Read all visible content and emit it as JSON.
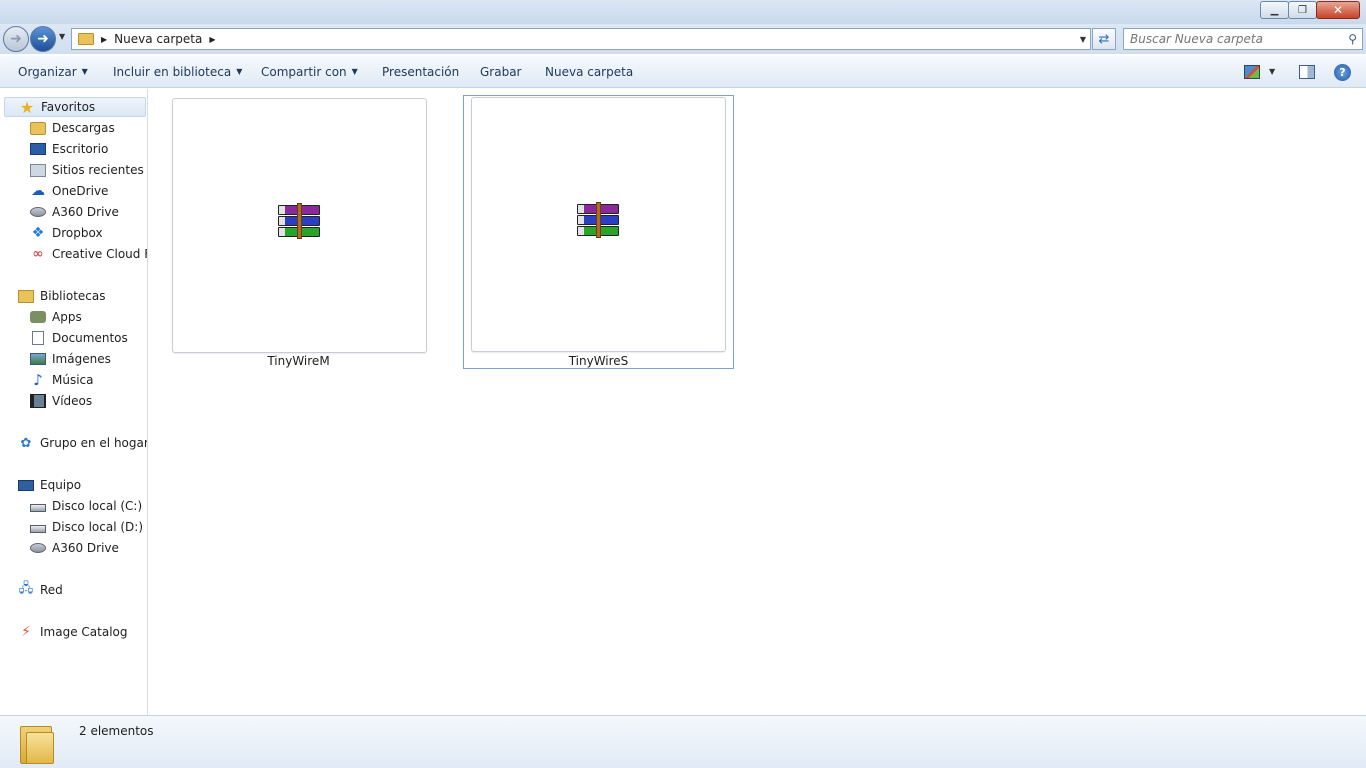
{
  "window": {
    "controls": {
      "minimize": "▁",
      "maximize": "❐",
      "close": "✕"
    }
  },
  "address": {
    "path": [
      "Nueva carpeta"
    ],
    "search_placeholder": "Buscar Nueva carpeta"
  },
  "toolbar": {
    "organize": "Organizar",
    "include_library": "Incluir en biblioteca",
    "share": "Compartir con",
    "presentation": "Presentación",
    "burn": "Grabar",
    "new_folder": "Nueva carpeta"
  },
  "navigation": {
    "favorites": {
      "label": "Favoritos",
      "items": [
        "Descargas",
        "Escritorio",
        "Sitios recientes",
        "OneDrive",
        "A360 Drive",
        "Dropbox",
        "Creative Cloud Files"
      ]
    },
    "libraries": {
      "label": "Bibliotecas",
      "items": [
        "Apps",
        "Documentos",
        "Imágenes",
        "Música",
        "Vídeos"
      ]
    },
    "homegroup": {
      "label": "Grupo en el hogar"
    },
    "computer": {
      "label": "Equipo",
      "items": [
        "Disco local (C:)",
        "Disco local (D:)",
        "A360 Drive"
      ]
    },
    "network": {
      "label": "Red"
    },
    "catalog": {
      "label": "Image Catalog"
    }
  },
  "files": [
    {
      "name": "TinyWireM",
      "icon": "winrar-archive-icon",
      "selected": false
    },
    {
      "name": "TinyWireS",
      "icon": "winrar-archive-icon",
      "selected": true
    }
  ],
  "status": {
    "count": "2 elementos"
  }
}
